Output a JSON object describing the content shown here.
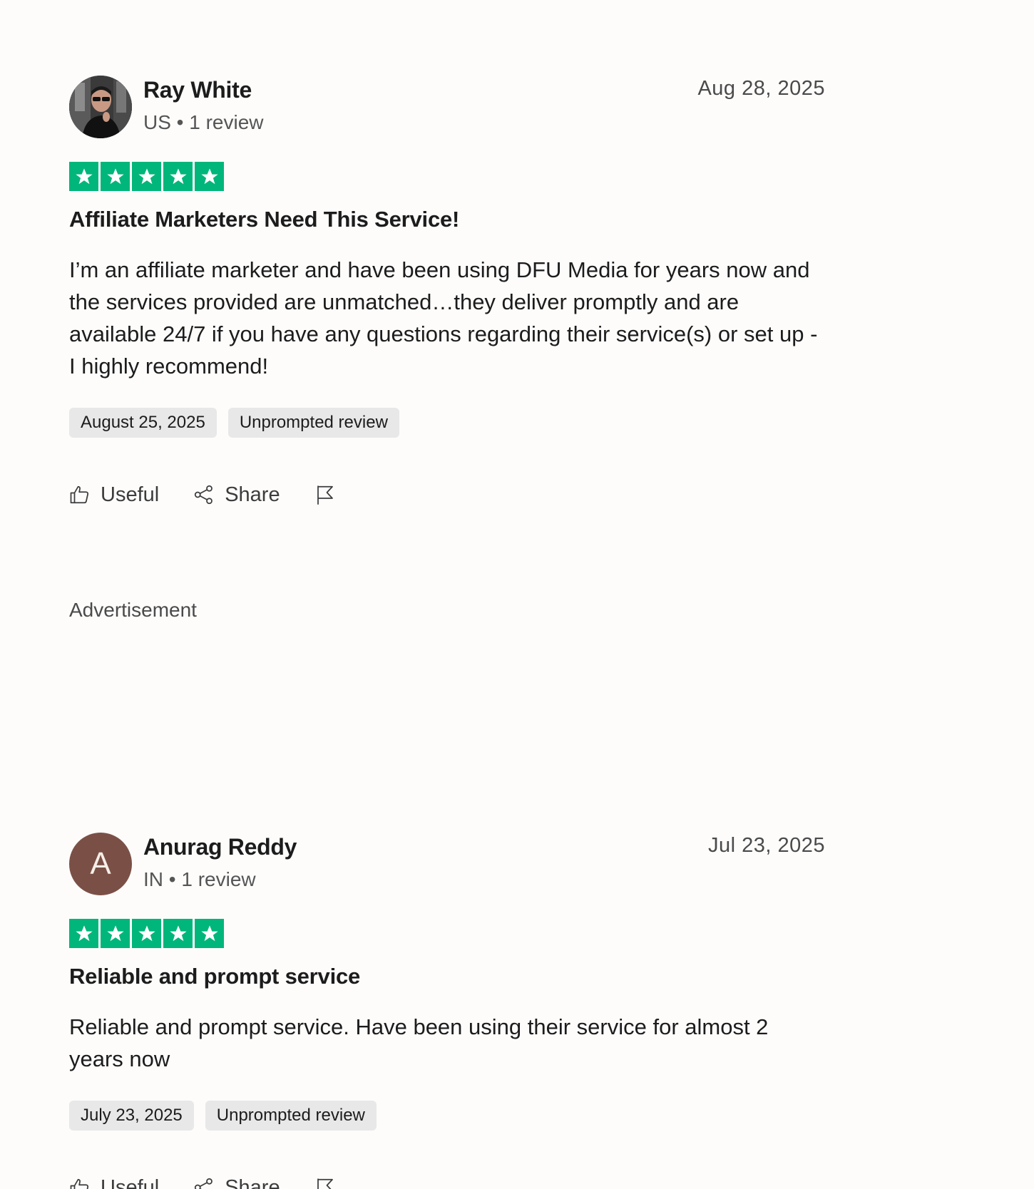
{
  "reviews": [
    {
      "name": "Ray White",
      "meta": "US • 1 review",
      "date": "Aug 28, 2025",
      "rating": 5,
      "title": "Affiliate Marketers Need This Service!",
      "body": "I’m an affiliate marketer and have been using DFU Media for years now and the services provided are unmatched…they deliver promptly and are available 24/7 if you have any questions regarding their service(s) or set up - I highly recommend!",
      "experience_date": "August 25, 2025",
      "tag": "Unprompted review",
      "useful_label": "Useful",
      "share_label": "Share"
    },
    {
      "name": "Anurag Reddy",
      "avatar_letter": "A",
      "meta": "IN • 1 review",
      "date": "Jul 23, 2025",
      "rating": 5,
      "title": "Reliable and prompt service",
      "body": "Reliable and prompt service. Have been using their service for almost 2 years now",
      "experience_date": "July 23, 2025",
      "tag": "Unprompted review",
      "useful_label": "Useful",
      "share_label": "Share"
    }
  ],
  "advertisement_label": "Advertisement",
  "colors": {
    "star_green": "#00b67a",
    "tag_bg": "#e8e8e8",
    "avatar_letter_bg": "#7a5046"
  },
  "icons": [
    "thumbs-up-icon",
    "share-icon",
    "flag-icon",
    "star-icon"
  ]
}
